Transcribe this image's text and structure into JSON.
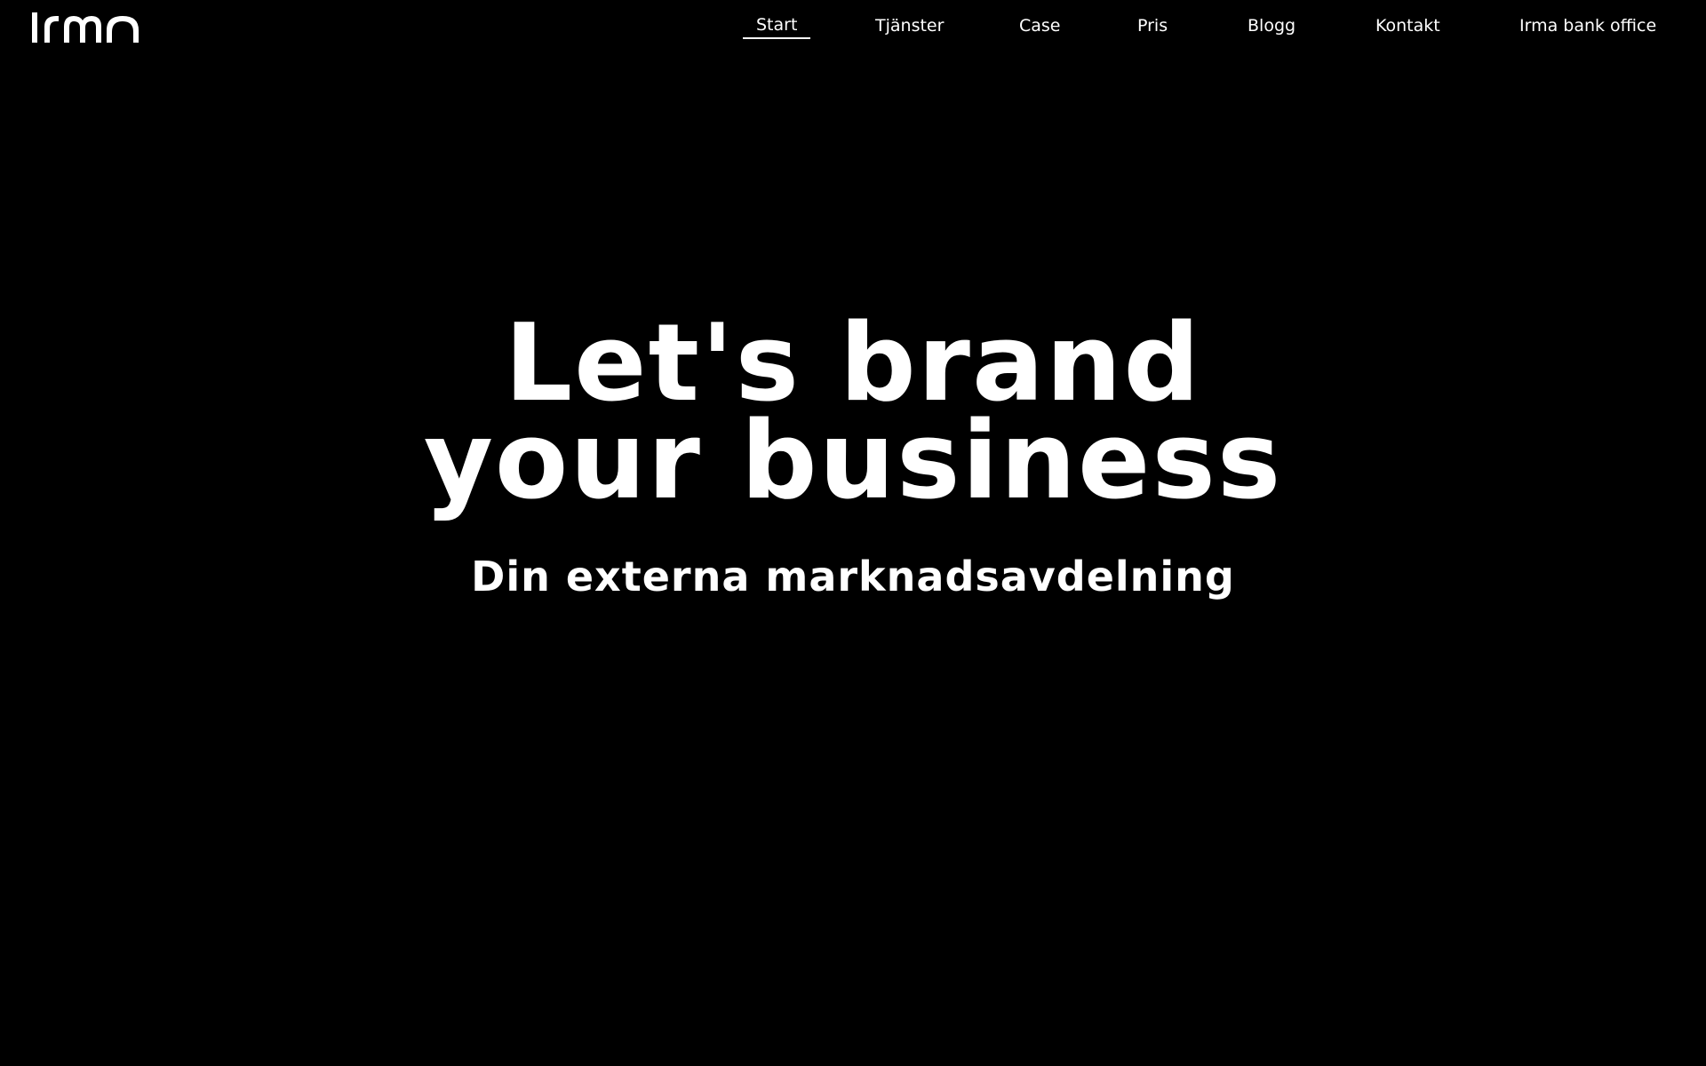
{
  "brand": {
    "logo_text": "irma",
    "logo_icon": "irma-wordmark-logo"
  },
  "nav": {
    "items": [
      {
        "label": "Start",
        "active": true
      },
      {
        "label": "Tjänster",
        "active": false
      },
      {
        "label": "Case",
        "active": false
      },
      {
        "label": "Pris",
        "active": false
      },
      {
        "label": "Blogg",
        "active": false
      },
      {
        "label": "Kontakt",
        "active": false
      },
      {
        "label": "Irma bank office",
        "active": false
      }
    ]
  },
  "hero": {
    "title_line1": "Let's brand",
    "title_line2": "your business",
    "subtitle": "Din externa marknadsavdelning"
  },
  "colors": {
    "background": "#000000",
    "text": "#ffffff"
  }
}
